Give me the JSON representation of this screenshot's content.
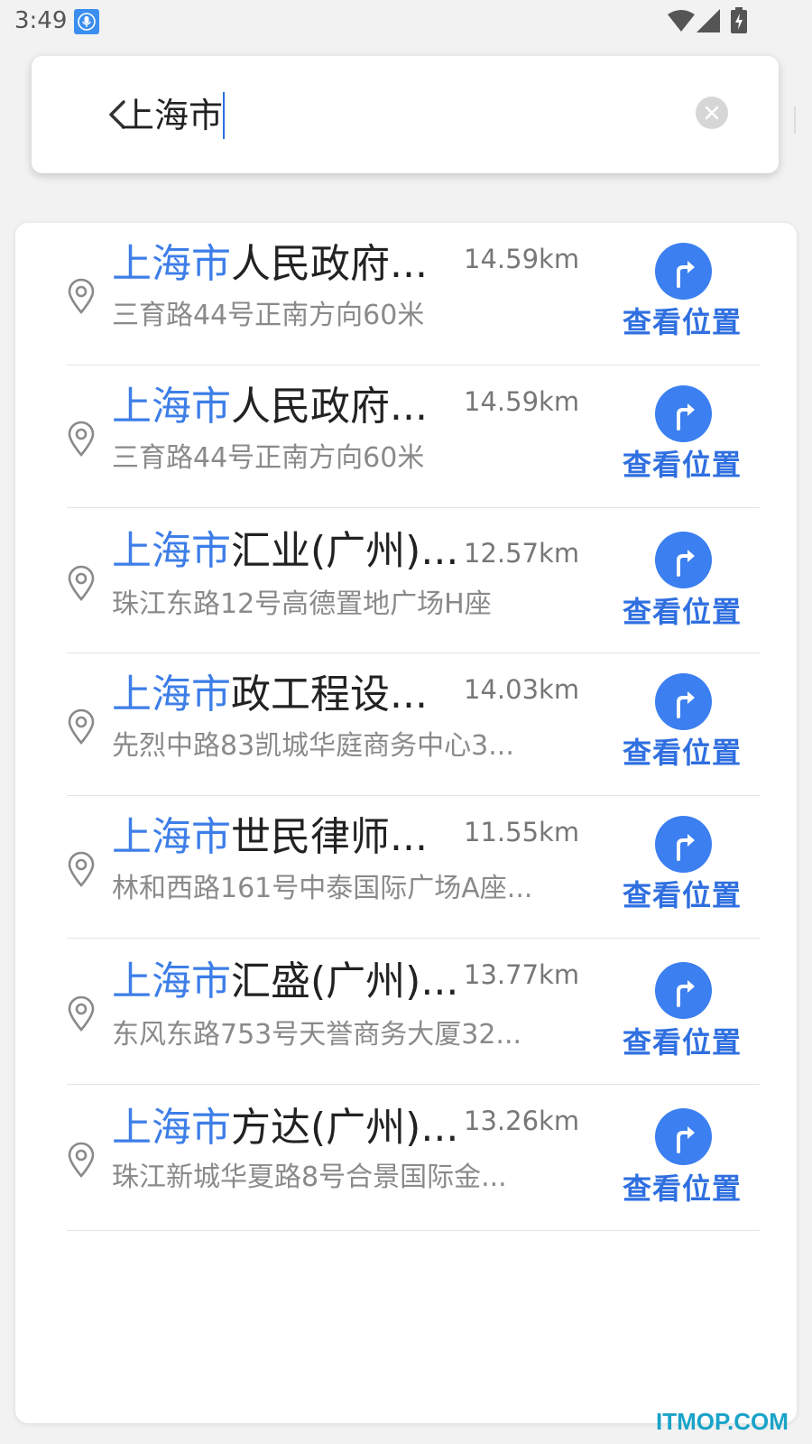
{
  "status_bar": {
    "time": "3:49"
  },
  "search": {
    "query": "上海市"
  },
  "results": [
    {
      "highlight": "上海市",
      "name": "人民政府",
      "address": "三育路44号正南方向60米",
      "distance": "14.59km",
      "action": "查看位置"
    },
    {
      "highlight": "上海市",
      "name": "人民政府",
      "address": "三育路44号正南方向60米",
      "distance": "14.59km",
      "action": "查看位置"
    },
    {
      "highlight": "上海市",
      "name": "汇业(广州)",
      "address": "珠江东路12号高德置地广场H座",
      "distance": "12.57km",
      "action": "查看位置"
    },
    {
      "highlight": "上海市",
      "name": "政工程设",
      "address": "先烈中路83凯城华庭商务中心3...",
      "distance": "14.03km",
      "action": "查看位置"
    },
    {
      "highlight": "上海市",
      "name": "世民律师",
      "address": "林和西路161号中泰国际广场A座...",
      "distance": "11.55km",
      "action": "查看位置"
    },
    {
      "highlight": "上海市",
      "name": "汇盛(广州)",
      "address": "东风东路753号天誉商务大厦32...",
      "distance": "13.77km",
      "action": "查看位置"
    },
    {
      "highlight": "上海市",
      "name": "方达(广州)",
      "address": "珠江新城华夏路8号合景国际金...",
      "distance": "13.26km",
      "action": "查看位置"
    }
  ],
  "ellipsis": "...",
  "watermark": "ITMOP.COM",
  "colors": {
    "accent": "#3b7ff0",
    "highlight": "#3d7ee8",
    "action_text": "#2f6fe0"
  },
  "icons": {
    "back": "chevron-left-icon",
    "clear": "clear-circle-icon",
    "pin": "location-pin-icon",
    "nav": "route-turn-icon"
  }
}
